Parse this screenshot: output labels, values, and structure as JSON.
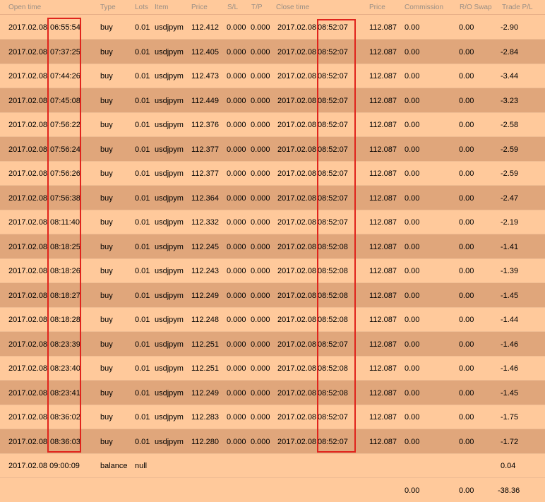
{
  "headers": [
    "Open time",
    "Type",
    "Lots",
    "Item",
    "Price",
    "S/L",
    "T/P",
    "Close time",
    "Price",
    "Commission",
    "R/O Swap",
    "Trade P/L"
  ],
  "trades": [
    {
      "open_date": "2017.02.08",
      "open_time": "06:55:54",
      "type": "buy",
      "lots": "0.01",
      "item": "usdjpym",
      "price": "112.412",
      "sl": "0.000",
      "tp": "0.000",
      "close_date": "2017.02.08",
      "close_time": "08:52:07",
      "close_price": "112.087",
      "commission": "0.00",
      "swap": "0.00",
      "pl": "-2.90"
    },
    {
      "open_date": "2017.02.08",
      "open_time": "07:37:25",
      "type": "buy",
      "lots": "0.01",
      "item": "usdjpym",
      "price": "112.405",
      "sl": "0.000",
      "tp": "0.000",
      "close_date": "2017.02.08",
      "close_time": "08:52:07",
      "close_price": "112.087",
      "commission": "0.00",
      "swap": "0.00",
      "pl": "-2.84"
    },
    {
      "open_date": "2017.02.08",
      "open_time": "07:44:26",
      "type": "buy",
      "lots": "0.01",
      "item": "usdjpym",
      "price": "112.473",
      "sl": "0.000",
      "tp": "0.000",
      "close_date": "2017.02.08",
      "close_time": "08:52:07",
      "close_price": "112.087",
      "commission": "0.00",
      "swap": "0.00",
      "pl": "-3.44"
    },
    {
      "open_date": "2017.02.08",
      "open_time": "07:45:08",
      "type": "buy",
      "lots": "0.01",
      "item": "usdjpym",
      "price": "112.449",
      "sl": "0.000",
      "tp": "0.000",
      "close_date": "2017.02.08",
      "close_time": "08:52:07",
      "close_price": "112.087",
      "commission": "0.00",
      "swap": "0.00",
      "pl": "-3.23"
    },
    {
      "open_date": "2017.02.08",
      "open_time": "07:56:22",
      "type": "buy",
      "lots": "0.01",
      "item": "usdjpym",
      "price": "112.376",
      "sl": "0.000",
      "tp": "0.000",
      "close_date": "2017.02.08",
      "close_time": "08:52:07",
      "close_price": "112.087",
      "commission": "0.00",
      "swap": "0.00",
      "pl": "-2.58"
    },
    {
      "open_date": "2017.02.08",
      "open_time": "07:56:24",
      "type": "buy",
      "lots": "0.01",
      "item": "usdjpym",
      "price": "112.377",
      "sl": "0.000",
      "tp": "0.000",
      "close_date": "2017.02.08",
      "close_time": "08:52:07",
      "close_price": "112.087",
      "commission": "0.00",
      "swap": "0.00",
      "pl": "-2.59"
    },
    {
      "open_date": "2017.02.08",
      "open_time": "07:56:26",
      "type": "buy",
      "lots": "0.01",
      "item": "usdjpym",
      "price": "112.377",
      "sl": "0.000",
      "tp": "0.000",
      "close_date": "2017.02.08",
      "close_time": "08:52:07",
      "close_price": "112.087",
      "commission": "0.00",
      "swap": "0.00",
      "pl": "-2.59"
    },
    {
      "open_date": "2017.02.08",
      "open_time": "07:56:38",
      "type": "buy",
      "lots": "0.01",
      "item": "usdjpym",
      "price": "112.364",
      "sl": "0.000",
      "tp": "0.000",
      "close_date": "2017.02.08",
      "close_time": "08:52:07",
      "close_price": "112.087",
      "commission": "0.00",
      "swap": "0.00",
      "pl": "-2.47"
    },
    {
      "open_date": "2017.02.08",
      "open_time": "08:11:40",
      "type": "buy",
      "lots": "0.01",
      "item": "usdjpym",
      "price": "112.332",
      "sl": "0.000",
      "tp": "0.000",
      "close_date": "2017.02.08",
      "close_time": "08:52:07",
      "close_price": "112.087",
      "commission": "0.00",
      "swap": "0.00",
      "pl": "-2.19"
    },
    {
      "open_date": "2017.02.08",
      "open_time": "08:18:25",
      "type": "buy",
      "lots": "0.01",
      "item": "usdjpym",
      "price": "112.245",
      "sl": "0.000",
      "tp": "0.000",
      "close_date": "2017.02.08",
      "close_time": "08:52:08",
      "close_price": "112.087",
      "commission": "0.00",
      "swap": "0.00",
      "pl": "-1.41"
    },
    {
      "open_date": "2017.02.08",
      "open_time": "08:18:26",
      "type": "buy",
      "lots": "0.01",
      "item": "usdjpym",
      "price": "112.243",
      "sl": "0.000",
      "tp": "0.000",
      "close_date": "2017.02.08",
      "close_time": "08:52:08",
      "close_price": "112.087",
      "commission": "0.00",
      "swap": "0.00",
      "pl": "-1.39"
    },
    {
      "open_date": "2017.02.08",
      "open_time": "08:18:27",
      "type": "buy",
      "lots": "0.01",
      "item": "usdjpym",
      "price": "112.249",
      "sl": "0.000",
      "tp": "0.000",
      "close_date": "2017.02.08",
      "close_time": "08:52:08",
      "close_price": "112.087",
      "commission": "0.00",
      "swap": "0.00",
      "pl": "-1.45"
    },
    {
      "open_date": "2017.02.08",
      "open_time": "08:18:28",
      "type": "buy",
      "lots": "0.01",
      "item": "usdjpym",
      "price": "112.248",
      "sl": "0.000",
      "tp": "0.000",
      "close_date": "2017.02.08",
      "close_time": "08:52:08",
      "close_price": "112.087",
      "commission": "0.00",
      "swap": "0.00",
      "pl": "-1.44"
    },
    {
      "open_date": "2017.02.08",
      "open_time": "08:23:39",
      "type": "buy",
      "lots": "0.01",
      "item": "usdjpym",
      "price": "112.251",
      "sl": "0.000",
      "tp": "0.000",
      "close_date": "2017.02.08",
      "close_time": "08:52:07",
      "close_price": "112.087",
      "commission": "0.00",
      "swap": "0.00",
      "pl": "-1.46"
    },
    {
      "open_date": "2017.02.08",
      "open_time": "08:23:40",
      "type": "buy",
      "lots": "0.01",
      "item": "usdjpym",
      "price": "112.251",
      "sl": "0.000",
      "tp": "0.000",
      "close_date": "2017.02.08",
      "close_time": "08:52:08",
      "close_price": "112.087",
      "commission": "0.00",
      "swap": "0.00",
      "pl": "-1.46"
    },
    {
      "open_date": "2017.02.08",
      "open_time": "08:23:41",
      "type": "buy",
      "lots": "0.01",
      "item": "usdjpym",
      "price": "112.249",
      "sl": "0.000",
      "tp": "0.000",
      "close_date": "2017.02.08",
      "close_time": "08:52:08",
      "close_price": "112.087",
      "commission": "0.00",
      "swap": "0.00",
      "pl": "-1.45"
    },
    {
      "open_date": "2017.02.08",
      "open_time": "08:36:02",
      "type": "buy",
      "lots": "0.01",
      "item": "usdjpym",
      "price": "112.283",
      "sl": "0.000",
      "tp": "0.000",
      "close_date": "2017.02.08",
      "close_time": "08:52:07",
      "close_price": "112.087",
      "commission": "0.00",
      "swap": "0.00",
      "pl": "-1.75"
    },
    {
      "open_date": "2017.02.08",
      "open_time": "08:36:03",
      "type": "buy",
      "lots": "0.01",
      "item": "usdjpym",
      "price": "112.280",
      "sl": "0.000",
      "tp": "0.000",
      "close_date": "2017.02.08",
      "close_time": "08:52:07",
      "close_price": "112.087",
      "commission": "0.00",
      "swap": "0.00",
      "pl": "-1.72"
    }
  ],
  "balance_row": {
    "open_datetime": "2017.02.08 09:00:09",
    "type": "balance",
    "lots": "null",
    "pl": "0.04"
  },
  "totals": {
    "commission": "0.00",
    "swap": "0.00",
    "pl": "-38.36"
  },
  "colors": {
    "background": "#ffc99b",
    "alt_row": "#e0a67b",
    "highlight": "#e0241c",
    "header_text": "#9a8f85"
  }
}
